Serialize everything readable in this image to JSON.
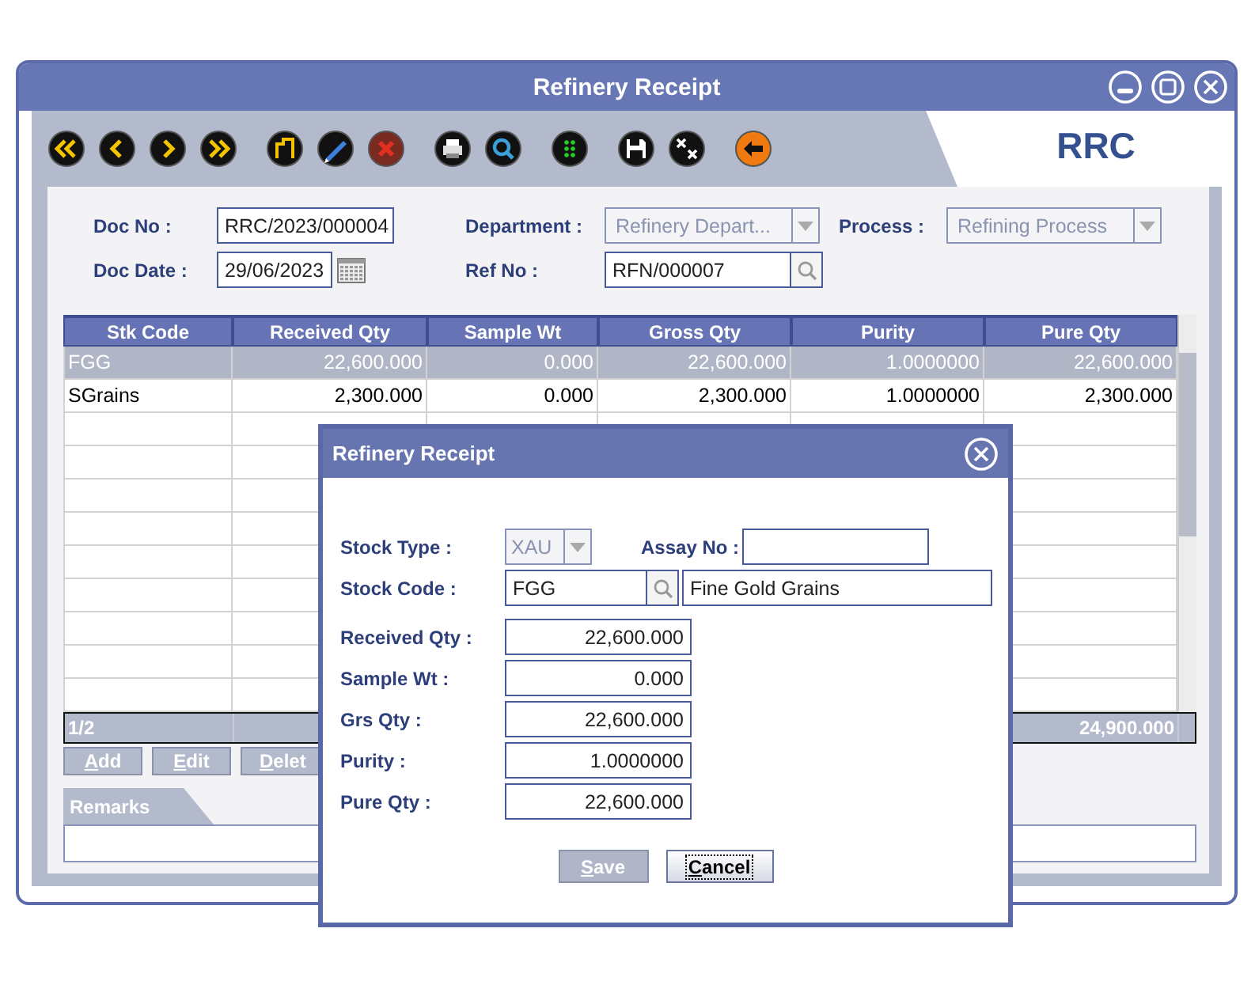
{
  "window": {
    "title": "Refinery Receipt",
    "tab": "RRC"
  },
  "header_fields": [
    {
      "kind": "text",
      "label": "Doc No :",
      "value": "RRC/2023/000004"
    },
    {
      "kind": "combo",
      "label": "Department :",
      "value": "Refinery Depart...",
      "disabled": true
    },
    {
      "kind": "combo",
      "label": "Process :",
      "value": "Refining Process",
      "disabled": true
    },
    {
      "kind": "date",
      "label": "Doc Date :",
      "value": "29/06/2023"
    },
    {
      "kind": "lookup",
      "label": "Ref No :",
      "value": "RFN/000007"
    }
  ],
  "table": {
    "columns": [
      "Stk Code",
      "Received Qty",
      "Sample Wt",
      "Gross Qty",
      "Purity",
      "Pure Qty"
    ],
    "rows": [
      {
        "selected": true,
        "cells": [
          "FGG",
          "22,600.000",
          "0.000",
          "22,600.000",
          "1.0000000",
          "22,600.000"
        ]
      },
      {
        "selected": false,
        "cells": [
          "SGrains",
          "2,300.000",
          "0.000",
          "2,300.000",
          "1.0000000",
          "2,300.000"
        ]
      }
    ],
    "footer": {
      "page": "1/2",
      "total": "24,900.000"
    }
  },
  "row_buttons": [
    {
      "label": "Add",
      "mnemonic": true
    },
    {
      "label": "Edit",
      "mnemonic": true
    },
    {
      "label": "Delet",
      "mnemonic": true
    }
  ],
  "remarks": {
    "tab": "Remarks"
  },
  "dialog": {
    "title": "Refinery Receipt",
    "stock_type": {
      "label": "Stock Type :",
      "value": "XAU",
      "disabled": true
    },
    "assay_no": {
      "label": "Assay No :"
    },
    "stock_code": {
      "label": "Stock Code :",
      "value": "FGG",
      "description": "Fine Gold Grains"
    },
    "amounts": [
      {
        "label": "Received Qty :",
        "value": "22,600.000"
      },
      {
        "label": "Sample Wt :",
        "value": "0.000"
      },
      {
        "label": "Grs Qty :",
        "value": "22,600.000"
      },
      {
        "label": "Purity :",
        "value": "1.0000000"
      },
      {
        "label": "Pure Qty :",
        "value": "22,600.000"
      }
    ],
    "buttons": [
      {
        "label": "Save",
        "mnemonic": true,
        "disabled": true,
        "focused": false
      },
      {
        "label": "Cancel",
        "mnemonic": true,
        "disabled": false,
        "focused": true
      }
    ]
  }
}
